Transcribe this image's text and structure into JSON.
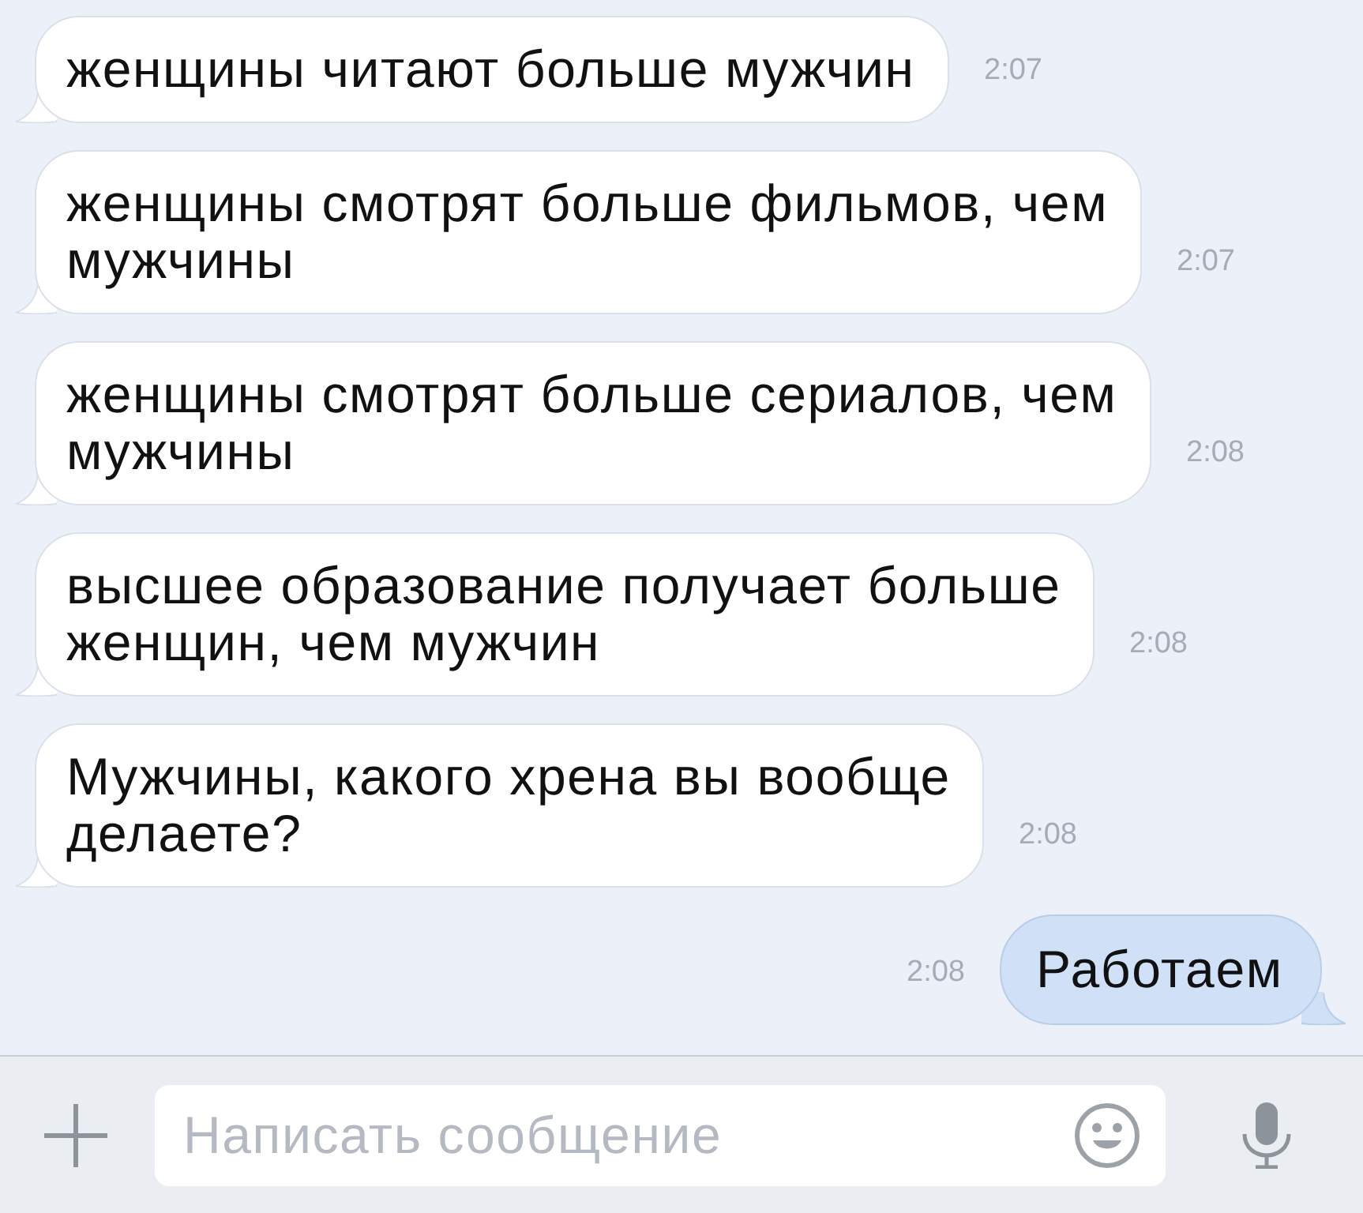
{
  "messages": [
    {
      "kind": "incoming",
      "text": "женщины читают больше мужчин",
      "time": "2:07"
    },
    {
      "kind": "incoming",
      "text": "женщины смотрят больше фильмов, чем мужчины",
      "time": "2:07"
    },
    {
      "kind": "incoming",
      "text": "женщины смотрят больше сериалов, чем мужчины",
      "time": "2:08"
    },
    {
      "kind": "incoming",
      "text": "высшее образование получает больше женщин, чем мужчин",
      "time": "2:08"
    },
    {
      "kind": "incoming",
      "text": "Мужчины, какого хрена вы вообще делаете?",
      "time": "2:08"
    },
    {
      "kind": "outgoing",
      "text": "Работаем",
      "time": "2:08"
    }
  ],
  "composer": {
    "placeholder": "Написать сообщение"
  }
}
